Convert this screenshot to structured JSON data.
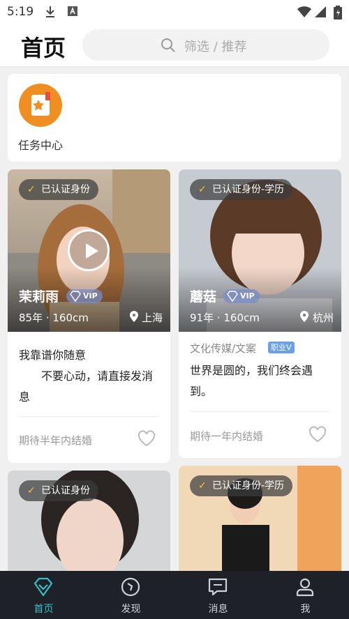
{
  "status_bar": {
    "time": "5:19"
  },
  "header": {
    "title": "首页",
    "search_placeholder": "筛选 / 推荐"
  },
  "task_center": {
    "label": "任务中心"
  },
  "profiles": [
    {
      "verify": "已认证身份",
      "name": "茉莉雨",
      "vip": "VIP",
      "meta": "85年 · 160cm",
      "city": "上海",
      "intro_line1": "我靠谱你随意",
      "intro_line2": "　　不要心动，请直接发消",
      "intro_line3": "息",
      "wish": "期待半年内结婚"
    },
    {
      "verify": "已认证身份-学历",
      "name": "蘑菇",
      "vip": "VIP",
      "meta": "91年 · 160cm",
      "city": "杭州",
      "occupation": "文化传媒/文案",
      "job_badge": "职业V",
      "intro_line1": "世界是圆的，我们终会遇",
      "intro_line2": "到。",
      "wish": "期待一年内结婚"
    },
    {
      "verify": "已认证身份"
    },
    {
      "verify": "已认证身份-学历"
    }
  ],
  "tabs": [
    {
      "label": "首页",
      "icon": "diamond-icon"
    },
    {
      "label": "发现",
      "icon": "compass-icon"
    },
    {
      "label": "消息",
      "icon": "message-icon"
    },
    {
      "label": "我",
      "icon": "profile-icon"
    }
  ],
  "colors": {
    "accent": "#2fc0c9",
    "tabbar": "#1e2127",
    "task_orange": "#ef8f22"
  }
}
